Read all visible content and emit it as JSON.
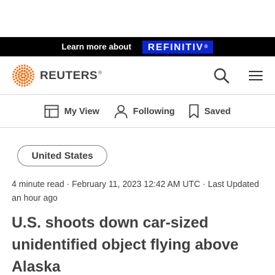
{
  "promo": {
    "text": "Learn more about",
    "brand": "REFINITIV",
    "brand_mark": "®",
    "brand_color": "#0a24d6"
  },
  "header": {
    "logo_text": "REUTERS",
    "logo_mark": "®",
    "logo_accent_color": "#fa6400",
    "search_icon": "search-icon",
    "menu_icon": "hamburger-menu-icon"
  },
  "nav": {
    "items": [
      {
        "label": "My View",
        "icon": "grid-layout-icon"
      },
      {
        "label": "Following",
        "icon": "person-icon"
      },
      {
        "label": "Saved",
        "icon": "bookmark-icon"
      }
    ]
  },
  "article": {
    "tag": "United States",
    "meta": "4 minute read · February 11, 2023 12:42 AM UTC · Last Updated an hour ago",
    "headline": "U.S. shoots down car-sized unidentified object flying above Alaska"
  }
}
